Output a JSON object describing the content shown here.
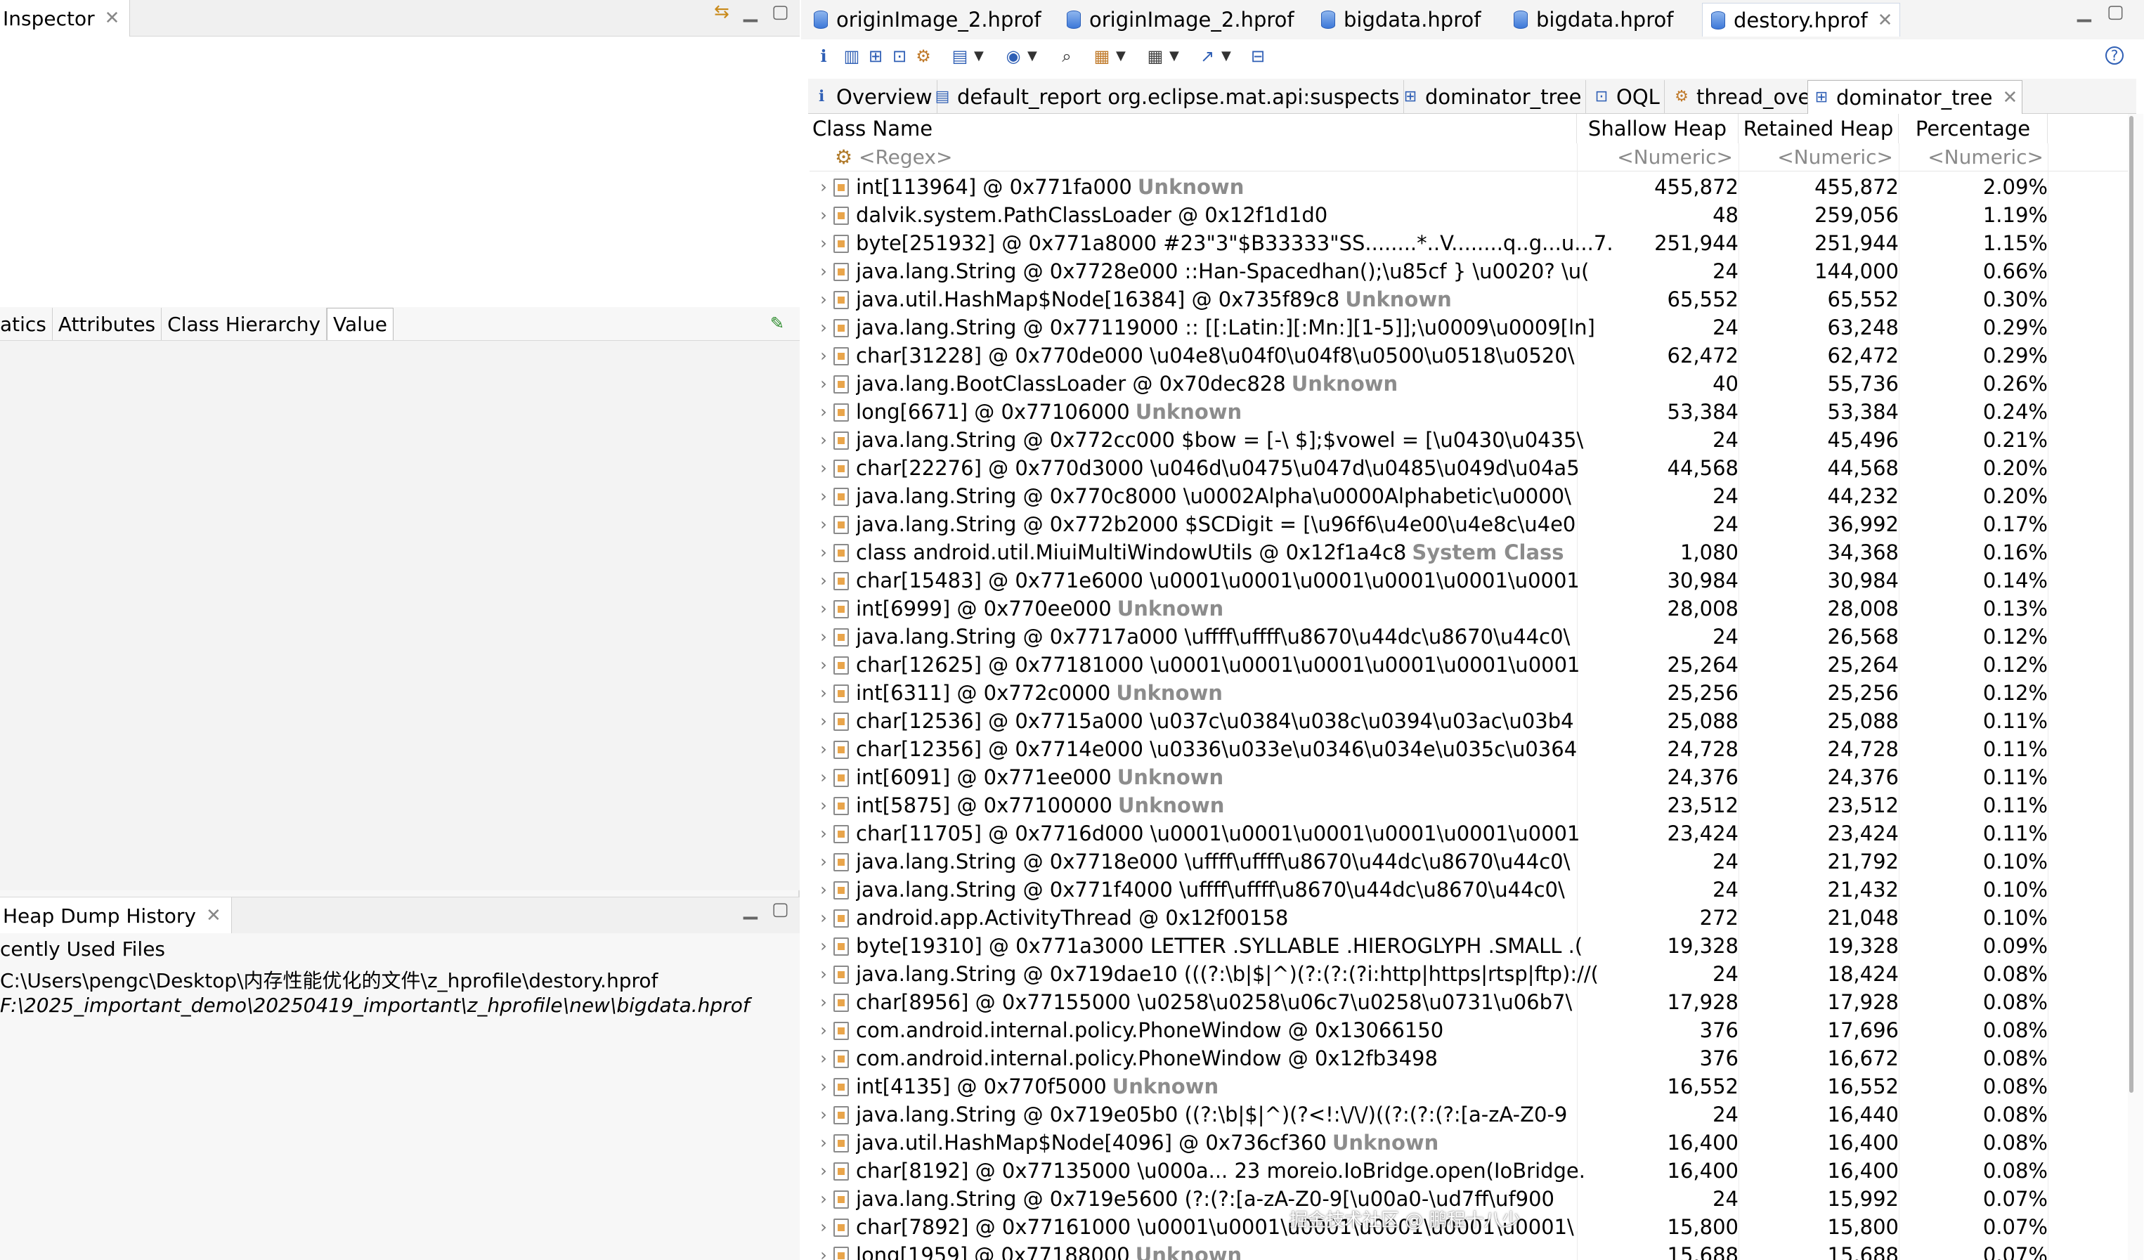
{
  "left": {
    "inspector_tab": "Inspector",
    "inspector_subtabs": [
      "atics",
      "Attributes",
      "Class Hierarchy",
      "Value"
    ],
    "history_tab": "Heap Dump History",
    "history_lines": [
      "cently Used Files",
      "C:\\Users\\pengc\\Desktop\\内存性能优化的文件\\z_hprofile\\destory.hprof",
      "F:\\2025_important_demo\\20250419_important\\z_hprofile\\new\\bigdata.hprof"
    ]
  },
  "editor_tabs": [
    {
      "label": "originImage_2.hprof",
      "active": false
    },
    {
      "label": "originImage_2.hprof",
      "active": false
    },
    {
      "label": "bigdata.hprof",
      "active": false
    },
    {
      "label": "bigdata.hprof",
      "active": false
    },
    {
      "label": "destory.hprof",
      "active": true
    }
  ],
  "inner_tabs": [
    {
      "label": "Overview",
      "icon": "info-icon"
    },
    {
      "label": "default_report org.eclipse.mat.api:suspects",
      "icon": "report-icon"
    },
    {
      "label": "dominator_tree",
      "icon": "tree-icon"
    },
    {
      "label": "OQL",
      "icon": "oql-icon"
    },
    {
      "label": "thread_overview",
      "icon": "gears-icon"
    },
    {
      "label": "dominator_tree",
      "icon": "tree-icon",
      "active": true
    }
  ],
  "table": {
    "columns": [
      "Class Name",
      "Shallow Heap",
      "Retained Heap",
      "Percentage"
    ],
    "filter_row": [
      "<Regex>",
      "<Numeric>",
      "<Numeric>",
      "<Numeric>"
    ],
    "rows": [
      {
        "name": "int[113964] @ 0x771fa000",
        "tag": "Unknown",
        "shallow": "455,872",
        "retained": "455,872",
        "pct": "2.09%"
      },
      {
        "name": "dalvik.system.PathClassLoader @ 0x12f1d1d0",
        "tag": "",
        "shallow": "48",
        "retained": "259,056",
        "pct": "1.19%"
      },
      {
        "name": "byte[251932] @ 0x771a8000  #23\"3\"$B33333\"SS........*..V........q..g...u...7.",
        "tag": "",
        "shallow": "251,944",
        "retained": "251,944",
        "pct": "1.15%"
      },
      {
        "name": "java.lang.String @ 0x7728e000  ::Han-Spacedhan();\\u85cf } \\u0020? \\u(",
        "tag": "",
        "shallow": "24",
        "retained": "144,000",
        "pct": "0.66%"
      },
      {
        "name": "java.util.HashMap$Node[16384] @ 0x735f89c8",
        "tag": "Unknown",
        "shallow": "65,552",
        "retained": "65,552",
        "pct": "0.30%"
      },
      {
        "name": "java.lang.String @ 0x77119000  :: [[:Latin:][:Mn:][1-5]];\\u0009\\u0009[ln]",
        "tag": "",
        "shallow": "24",
        "retained": "63,248",
        "pct": "0.29%"
      },
      {
        "name": "char[31228] @ 0x770de000  \\u04e8\\u04f0\\u04f8\\u0500\\u0518\\u0520\\",
        "tag": "",
        "shallow": "62,472",
        "retained": "62,472",
        "pct": "0.29%"
      },
      {
        "name": "java.lang.BootClassLoader @ 0x70dec828",
        "tag": "Unknown",
        "shallow": "40",
        "retained": "55,736",
        "pct": "0.26%"
      },
      {
        "name": "long[6671] @ 0x77106000",
        "tag": "Unknown",
        "shallow": "53,384",
        "retained": "53,384",
        "pct": "0.24%"
      },
      {
        "name": "java.lang.String @ 0x772cc000  $bow = [-\\ $];$vowel = [\\u0430\\u0435\\",
        "tag": "",
        "shallow": "24",
        "retained": "45,496",
        "pct": "0.21%"
      },
      {
        "name": "char[22276] @ 0x770d3000  \\u046d\\u0475\\u047d\\u0485\\u049d\\u04a5",
        "tag": "",
        "shallow": "44,568",
        "retained": "44,568",
        "pct": "0.20%"
      },
      {
        "name": "java.lang.String @ 0x770c8000  \\u0002Alpha\\u0000Alphabetic\\u0000\\",
        "tag": "",
        "shallow": "24",
        "retained": "44,232",
        "pct": "0.20%"
      },
      {
        "name": "java.lang.String @ 0x772b2000  $SCDigit = [\\u96f6\\u4e00\\u4e8c\\u4e0",
        "tag": "",
        "shallow": "24",
        "retained": "36,992",
        "pct": "0.17%"
      },
      {
        "name": "class android.util.MiuiMultiWindowUtils @ 0x12f1a4c8",
        "tag": "System Class",
        "shallow": "1,080",
        "retained": "34,368",
        "pct": "0.16%"
      },
      {
        "name": "char[15483] @ 0x771e6000  \\u0001\\u0001\\u0001\\u0001\\u0001\\u0001",
        "tag": "",
        "shallow": "30,984",
        "retained": "30,984",
        "pct": "0.14%"
      },
      {
        "name": "int[6999] @ 0x770ee000",
        "tag": "Unknown",
        "shallow": "28,008",
        "retained": "28,008",
        "pct": "0.13%"
      },
      {
        "name": "java.lang.String @ 0x7717a000  \\uffff\\uffff\\u8670\\u44dc\\u8670\\u44c0\\",
        "tag": "",
        "shallow": "24",
        "retained": "26,568",
        "pct": "0.12%"
      },
      {
        "name": "char[12625] @ 0x77181000  \\u0001\\u0001\\u0001\\u0001\\u0001\\u0001",
        "tag": "",
        "shallow": "25,264",
        "retained": "25,264",
        "pct": "0.12%"
      },
      {
        "name": "int[6311] @ 0x772c0000",
        "tag": "Unknown",
        "shallow": "25,256",
        "retained": "25,256",
        "pct": "0.12%"
      },
      {
        "name": "char[12536] @ 0x7715a000  \\u037c\\u0384\\u038c\\u0394\\u03ac\\u03b4",
        "tag": "",
        "shallow": "25,088",
        "retained": "25,088",
        "pct": "0.11%"
      },
      {
        "name": "char[12356] @ 0x7714e000  \\u0336\\u033e\\u0346\\u034e\\u035c\\u0364",
        "tag": "",
        "shallow": "24,728",
        "retained": "24,728",
        "pct": "0.11%"
      },
      {
        "name": "int[6091] @ 0x771ee000",
        "tag": "Unknown",
        "shallow": "24,376",
        "retained": "24,376",
        "pct": "0.11%"
      },
      {
        "name": "int[5875] @ 0x77100000",
        "tag": "Unknown",
        "shallow": "23,512",
        "retained": "23,512",
        "pct": "0.11%"
      },
      {
        "name": "char[11705] @ 0x7716d000  \\u0001\\u0001\\u0001\\u0001\\u0001\\u0001",
        "tag": "",
        "shallow": "23,424",
        "retained": "23,424",
        "pct": "0.11%"
      },
      {
        "name": "java.lang.String @ 0x7718e000  \\uffff\\uffff\\u8670\\u44dc\\u8670\\u44c0\\",
        "tag": "",
        "shallow": "24",
        "retained": "21,792",
        "pct": "0.10%"
      },
      {
        "name": "java.lang.String @ 0x771f4000  \\uffff\\uffff\\u8670\\u44dc\\u8670\\u44c0\\",
        "tag": "",
        "shallow": "24",
        "retained": "21,432",
        "pct": "0.10%"
      },
      {
        "name": "android.app.ActivityThread @ 0x12f00158",
        "tag": "",
        "shallow": "272",
        "retained": "21,048",
        "pct": "0.10%"
      },
      {
        "name": "byte[19310] @ 0x771a3000  LETTER .SYLLABLE .HIEROGLYPH .SMALL .(",
        "tag": "",
        "shallow": "19,328",
        "retained": "19,328",
        "pct": "0.09%"
      },
      {
        "name": "java.lang.String @ 0x719dae10  (((?:\\b|$|^)(?:(?:(?i:http|https|rtsp|ftp)://(",
        "tag": "",
        "shallow": "24",
        "retained": "18,424",
        "pct": "0.08%"
      },
      {
        "name": "char[8956] @ 0x77155000  \\u0258\\u0258\\u06c7\\u0258\\u0731\\u06b7\\",
        "tag": "",
        "shallow": "17,928",
        "retained": "17,928",
        "pct": "0.08%"
      },
      {
        "name": "com.android.internal.policy.PhoneWindow @ 0x13066150",
        "tag": "",
        "shallow": "376",
        "retained": "17,696",
        "pct": "0.08%"
      },
      {
        "name": "com.android.internal.policy.PhoneWindow @ 0x12fb3498",
        "tag": "",
        "shallow": "376",
        "retained": "16,672",
        "pct": "0.08%"
      },
      {
        "name": "int[4135] @ 0x770f5000",
        "tag": "Unknown",
        "shallow": "16,552",
        "retained": "16,552",
        "pct": "0.08%"
      },
      {
        "name": "java.lang.String @ 0x719e05b0  ((?:\\b|$|^)(?<!:\\/\\/)((?:(?:(?:[a-zA-Z0-9",
        "tag": "",
        "shallow": "24",
        "retained": "16,440",
        "pct": "0.08%"
      },
      {
        "name": "java.util.HashMap$Node[4096] @ 0x736cf360",
        "tag": "Unknown",
        "shallow": "16,400",
        "retained": "16,400",
        "pct": "0.08%"
      },
      {
        "name": "char[8192] @ 0x77135000  \\u000a... 23 moreio.IoBridge.open(IoBridge.",
        "tag": "",
        "shallow": "16,400",
        "retained": "16,400",
        "pct": "0.08%"
      },
      {
        "name": "java.lang.String @ 0x719e5600  (?:(?:[a-zA-Z0-9[\\u00a0-\\ud7ff\\uf900",
        "tag": "",
        "shallow": "24",
        "retained": "15,992",
        "pct": "0.07%"
      },
      {
        "name": "char[7892] @ 0x77161000  \\u0001\\u0001\\u0001\\u0001\\u0001\\u0001\\",
        "tag": "",
        "shallow": "15,800",
        "retained": "15,800",
        "pct": "0.07%"
      },
      {
        "name": "long[1959] @ 0x77188000",
        "tag": "Unknown",
        "shallow": "15,688",
        "retained": "15,688",
        "pct": "0.07%"
      }
    ]
  },
  "watermark": "掘金技术社区 @ 鹏程十八少"
}
